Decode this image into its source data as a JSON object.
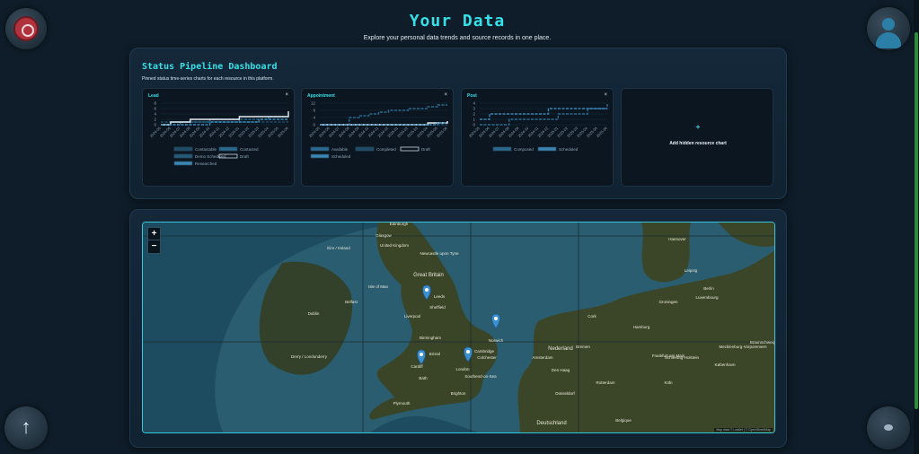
{
  "header": {
    "title": "Your Data",
    "subtitle": "Explore your personal data trends and source records in one place."
  },
  "pipeline": {
    "title": "Status Pipeline Dashboard",
    "subtitle": "Pinned status time-series charts for each resource in this platform.",
    "add_card_plus": "+",
    "add_card_label": "Add hidden resource chart",
    "close_glyph": "×"
  },
  "chart_data": [
    {
      "type": "line",
      "title": "Lead",
      "ylim": [
        0,
        8
      ],
      "yticks": [
        "8",
        "6",
        "4",
        "2",
        "0"
      ],
      "x": [
        "2024-05",
        "2024-06",
        "2024-07",
        "2024-08",
        "2024-09",
        "2024-10",
        "2024-11",
        "2024-12",
        "2025-01",
        "2025-02",
        "2025-03",
        "2025-04",
        "2025-05",
        "2025-06"
      ],
      "series": [
        {
          "name": "Contactable",
          "color": "#1f4c66",
          "values": [
            1,
            1,
            1,
            1,
            1,
            1,
            1,
            1,
            1,
            1,
            1,
            1,
            1,
            1
          ]
        },
        {
          "name": "Contacted",
          "color": "#2a6a90",
          "values": [
            0,
            0,
            1,
            1,
            1,
            2,
            2,
            2,
            2,
            2,
            2,
            3,
            3,
            3
          ]
        },
        {
          "name": "Demo Scheduled",
          "color": "#24597a",
          "values": [
            0,
            0,
            0,
            1,
            1,
            1,
            1,
            1,
            2,
            2,
            2,
            2,
            2,
            2
          ]
        },
        {
          "name": "Draft",
          "color": "#e6eef2",
          "values": [
            0,
            1,
            1,
            2,
            2,
            2,
            2,
            2,
            3,
            3,
            3,
            3,
            3,
            5
          ]
        },
        {
          "name": "Researched",
          "color": "#3a86b4",
          "values": [
            0,
            0,
            0,
            0,
            0,
            1,
            1,
            1,
            1,
            1,
            2,
            2,
            2,
            2
          ]
        }
      ],
      "legend": [
        "Contactable",
        "Contacted",
        "Demo Scheduled",
        "Draft",
        "Researched"
      ]
    },
    {
      "type": "line",
      "title": "Appointment",
      "ylim": [
        0,
        12
      ],
      "yticks": [
        "12",
        "8",
        "4",
        "0"
      ],
      "x": [
        "2024-05",
        "2024-06",
        "2024-07",
        "2024-08",
        "2024-09",
        "2024-10",
        "2024-11",
        "2024-12",
        "2025-01",
        "2025-02",
        "2025-03",
        "2025-04",
        "2025-05",
        "2025-06"
      ],
      "series": [
        {
          "name": "Available",
          "color": "#2a6a90",
          "values": [
            0,
            0,
            0,
            4,
            5,
            6,
            7,
            8,
            8,
            9,
            9,
            10,
            11,
            11
          ]
        },
        {
          "name": "Completed",
          "color": "#1f4c66",
          "values": [
            0,
            0,
            0,
            0,
            0,
            0,
            0,
            0,
            0,
            0,
            0,
            0,
            0,
            0
          ]
        },
        {
          "name": "Draft",
          "color": "#e6eef2",
          "values": [
            0,
            0,
            0,
            0,
            0,
            0,
            0,
            0,
            0,
            0,
            0,
            1,
            1,
            2
          ]
        },
        {
          "name": "Scheduled",
          "color": "#3a86b4",
          "values": [
            0,
            0,
            0,
            0,
            0,
            0,
            0,
            0,
            0,
            0,
            0,
            0,
            1,
            1
          ]
        }
      ],
      "legend": [
        "Available",
        "Completed",
        "Draft",
        "Scheduled"
      ]
    },
    {
      "type": "line",
      "title": "Post",
      "ylim": [
        0,
        4
      ],
      "yticks": [
        "4",
        "3",
        "2",
        "1",
        "0"
      ],
      "x": [
        "2024-05",
        "2024-06",
        "2024-07",
        "2024-08",
        "2024-09",
        "2024-10",
        "2024-11",
        "2024-12",
        "2025-01",
        "2025-02",
        "2025-03",
        "2025-04",
        "2025-05",
        "2025-06"
      ],
      "series": [
        {
          "name": "Composed",
          "color": "#2a6a90",
          "values": [
            0,
            0,
            0,
            1,
            1,
            1,
            1,
            1,
            2,
            2,
            2,
            3,
            3,
            4
          ]
        },
        {
          "name": "Scheduled",
          "color": "#3a86b4",
          "values": [
            1,
            2,
            2,
            2,
            2,
            2,
            2,
            3,
            3,
            3,
            3,
            3,
            3,
            3
          ]
        }
      ],
      "legend": [
        "Composed",
        "Scheduled"
      ]
    }
  ],
  "map": {
    "zoom_in": "+",
    "zoom_out": "−",
    "attribution": "Map data © Leaflet | © OpenStreetMap",
    "place_labels": [
      "Edinburgh",
      "Glasgow",
      "United Kingdom",
      "Newcastle upon Tyne",
      "Great Britain",
      "Leeds",
      "Sheffield",
      "Liverpool",
      "Birmingham",
      "Cambridge",
      "Norwich",
      "Colchester",
      "Bristol",
      "Cardiff",
      "Bath",
      "London",
      "Southend-on-Sea",
      "Brighton",
      "Plymouth",
      "Isle of Man",
      "Belfast",
      "Dublin",
      "Éire / Ireland",
      "Derry / Londonderry",
      "Cork",
      "Groningen",
      "Hamburg",
      "Bremen",
      "Nederland",
      "Amsterdam",
      "Den Haag",
      "Rotterdam",
      "Düsseldorf",
      "Köln",
      "Belgique",
      "Deutschland",
      "Frankfurt am Main",
      "Luxembourg",
      "Hannover",
      "Berlin",
      "Leipzig",
      "København",
      "Mecklenburg-Vorpommern",
      "Schleswig-Holstein",
      "Braunschweig"
    ],
    "marker_count": 4
  }
}
